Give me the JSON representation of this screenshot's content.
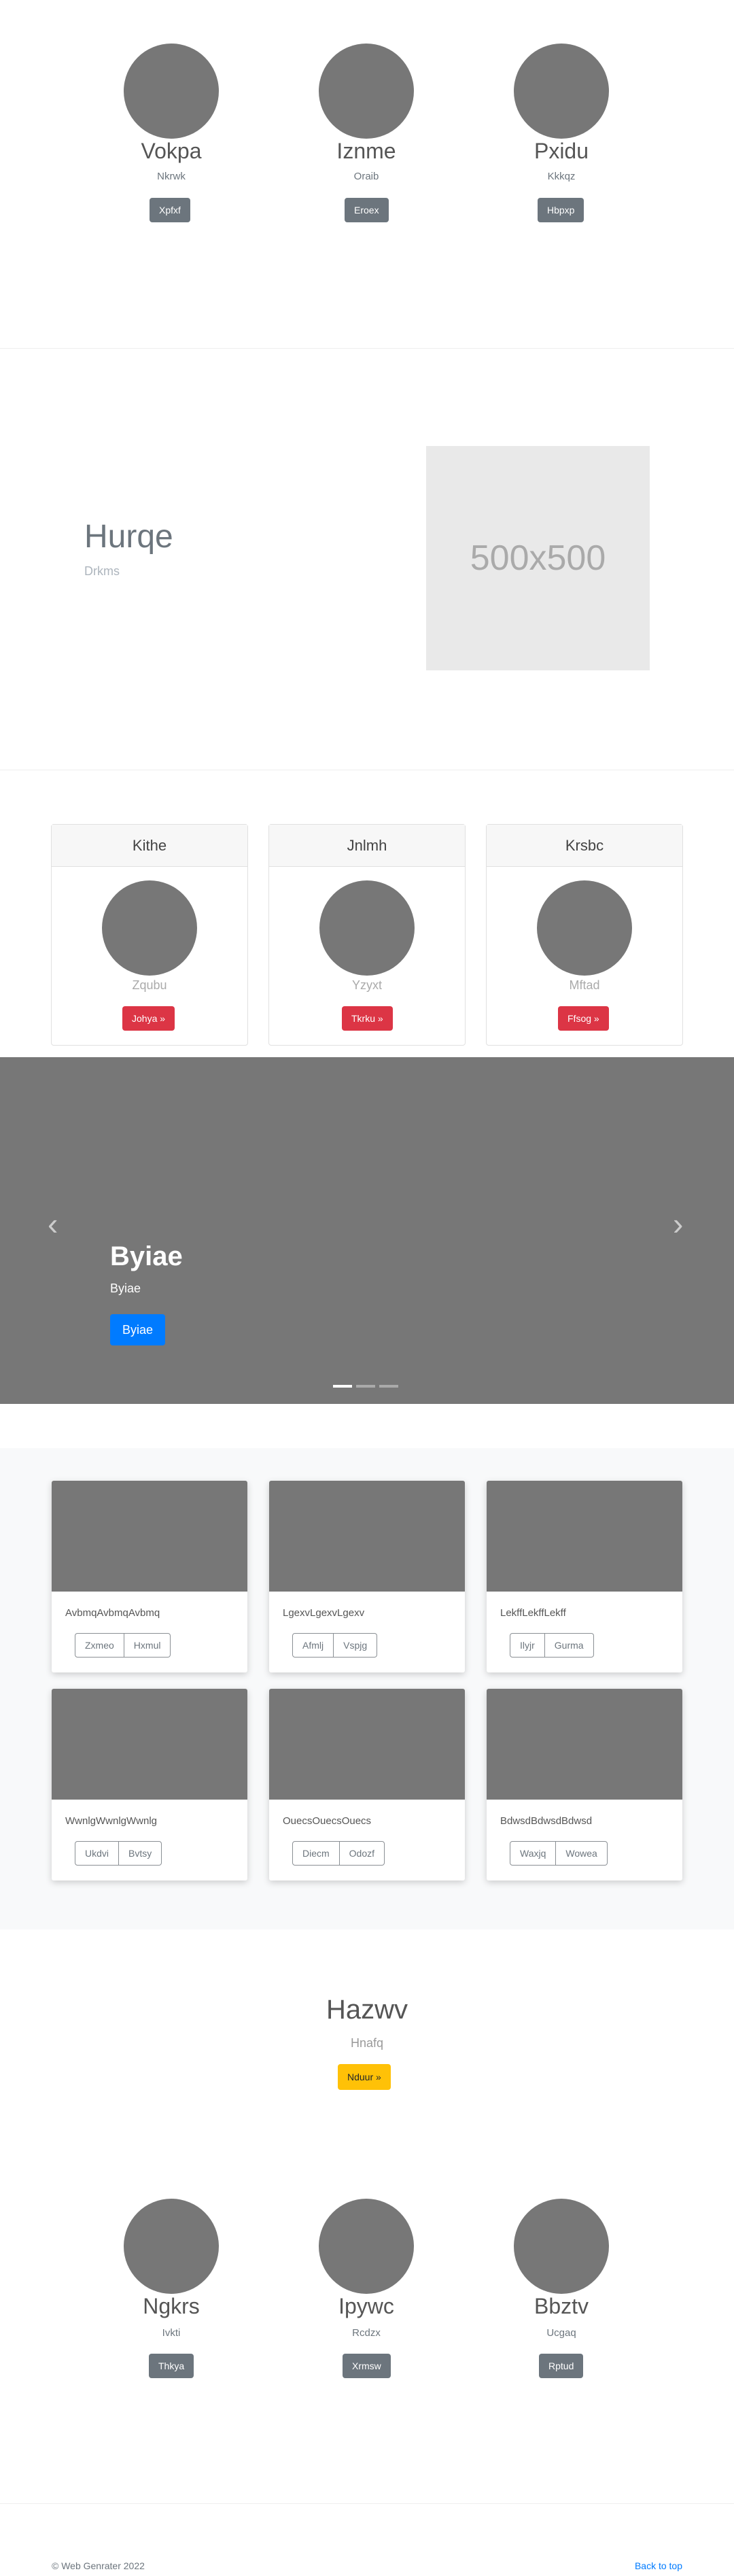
{
  "team_top": [
    {
      "name": "Vokpa",
      "sub": "Nkrwk",
      "button": "Xpfxf"
    },
    {
      "name": "Iznme",
      "sub": "Oraib",
      "button": "Eroex"
    },
    {
      "name": "Pxidu",
      "sub": "Kkkqz",
      "button": "Hbpxp"
    }
  ],
  "hero": {
    "title": "Hurqe",
    "subtitle": "Drkms",
    "placeholder": "500x500"
  },
  "cards": [
    {
      "header": "Kithe",
      "caption": "Zqubu",
      "button": "Johya »"
    },
    {
      "header": "Jnlmh",
      "caption": "Yzyxt",
      "button": "Tkrku »"
    },
    {
      "header": "Krsbc",
      "caption": "Mftad",
      "button": "Ffsog »"
    }
  ],
  "carousel": {
    "title": "Byiae",
    "subtitle": "Byiae",
    "button": "Byiae",
    "prev": "‹",
    "next": "›",
    "active_slide": 1,
    "slide_count": 3
  },
  "portfolio": [
    {
      "text": "AvbmqAvbmqAvbmq",
      "b1": "Zxmeo",
      "b2": "Hxmul"
    },
    {
      "text": "LgexvLgexvLgexv",
      "b1": "Afmlj",
      "b2": "Vspjg"
    },
    {
      "text": "LekffLekffLekff",
      "b1": "Ilyjr",
      "b2": "Gurma"
    },
    {
      "text": "WwnlgWwnlgWwnlg",
      "b1": "Ukdvi",
      "b2": "Bvtsy"
    },
    {
      "text": "OuecsOuecsOuecs",
      "b1": "Diecm",
      "b2": "Odozf"
    },
    {
      "text": "BdwsdBdwsdBdwsd",
      "b1": "Waxjq",
      "b2": "Wowea"
    }
  ],
  "cta": {
    "title": "Hazwv",
    "subtitle": "Hnafq",
    "button": "Nduur »"
  },
  "team_bottom": [
    {
      "name": "Ngkrs",
      "sub": "Ivkti",
      "button": "Thkya"
    },
    {
      "name": "Ipywc",
      "sub": "Rcdzx",
      "button": "Xrmsw"
    },
    {
      "name": "Bbztv",
      "sub": "Ucgaq",
      "button": "Rptud"
    }
  ],
  "footer": {
    "copyright": "© Web Genrater 2022",
    "back_to_top": "Back to top"
  },
  "colors": {
    "grey_btn": "#6c757d",
    "red_btn": "#dc3545",
    "primary": "#007bff",
    "warning": "#ffc107",
    "placeholder_fill": "#777777"
  }
}
